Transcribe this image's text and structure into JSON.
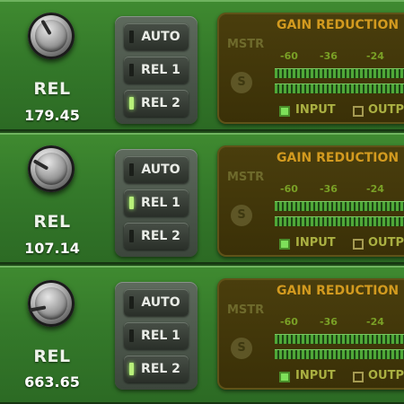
{
  "channels": [
    {
      "rel_label": "REL",
      "rel_value": "179.45",
      "buttons": [
        {
          "label": "AUTO",
          "active": false
        },
        {
          "label": "REL 1",
          "active": false
        },
        {
          "label": "REL 2",
          "active": true
        }
      ],
      "display": {
        "title": "GAIN REDUCTION",
        "mstr": "MSTR",
        "solo": "S",
        "ticks": [
          "-60",
          "-36",
          "-24"
        ],
        "input_label": "INPUT",
        "output_label": "OUTP",
        "input_checked": true,
        "output_checked": false
      }
    },
    {
      "rel_label": "REL",
      "rel_value": "107.14",
      "buttons": [
        {
          "label": "AUTO",
          "active": false
        },
        {
          "label": "REL 1",
          "active": true
        },
        {
          "label": "REL 2",
          "active": false
        }
      ],
      "display": {
        "title": "GAIN REDUCTION",
        "mstr": "MSTR",
        "solo": "S",
        "ticks": [
          "-60",
          "-36",
          "-24"
        ],
        "input_label": "INPUT",
        "output_label": "OUTP",
        "input_checked": true,
        "output_checked": false
      }
    },
    {
      "rel_label": "REL",
      "rel_value": "663.65",
      "buttons": [
        {
          "label": "AUTO",
          "active": false
        },
        {
          "label": "REL 1",
          "active": false
        },
        {
          "label": "REL 2",
          "active": true
        }
      ],
      "display": {
        "title": "GAIN REDUCTION",
        "mstr": "MSTR",
        "solo": "S",
        "ticks": [
          "-60",
          "-36",
          "-24"
        ],
        "input_label": "INPUT",
        "output_label": "OUTP",
        "input_checked": true,
        "output_checked": false
      }
    }
  ],
  "colors": {
    "panel_green": "#34792a",
    "display_bg": "#3a3007",
    "title_orange": "#d29a1f",
    "led_on": "#b8f07a",
    "meter_green": "#4fa838"
  }
}
